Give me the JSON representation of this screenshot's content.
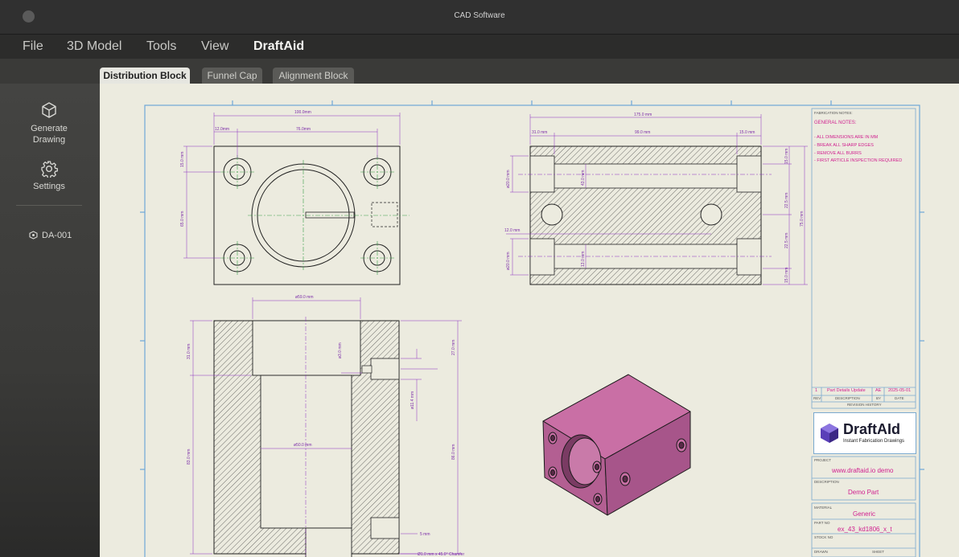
{
  "window": {
    "title": "CAD Software"
  },
  "menu": [
    "File",
    "3D Model",
    "Tools",
    "View",
    "DraftAid"
  ],
  "tabs": [
    "Distribution Block",
    "Funnel Cap",
    "Alignment Block"
  ],
  "sidebar": {
    "generate_label": "Generate Drawing",
    "settings_label": "Settings",
    "document": "DA-001"
  },
  "drawing": {
    "notes_header": "FABRICATION NOTES:",
    "notes_title": "GENERAL NOTES:",
    "notes": [
      "- ALL DIMENSIONS ARE IN MM",
      "- BREAK ALL SHARP EDGES",
      "- REMOVE ALL BURRS",
      "- FIRST ARTICLE INSPECTION REQUIRED"
    ],
    "revision": {
      "rev": "1",
      "description": "Part Details Update",
      "by": "AE",
      "date": "2025-05-01",
      "col_rev": "REV",
      "col_desc": "DESCRIPTION",
      "col_by": "BY",
      "col_date": "DATE",
      "footer": "REVISION HISTORY"
    },
    "logo": {
      "name": "DraftAId",
      "tagline": "Instant Fabrication Drawings"
    },
    "project_label": "PROJECT",
    "project": "www.draftaid.io demo",
    "description_label": "DESCRIPTION",
    "description": "Demo Part",
    "material_label": "MATERIAL",
    "material": "Generic",
    "part_no_label": "PART NO",
    "part_no": "ex_43_kd1806_x_t",
    "stock_no_label": "STOCK NO",
    "drawn_label": "DRAWN",
    "sheet_label": "SHEET",
    "dims": {
      "top_overall": "100.0mm",
      "top_left": "12.0mm",
      "top_mid": "76.0mm",
      "top_left_v1": "15.0 mm",
      "top_left_v2": "65.0 mm",
      "side_overall": "175.0 mm",
      "side_left": "31.0 mm",
      "side_mid": "99.0 mm",
      "side_right": "15.0 mm",
      "side_v_left1": "ø20.0 mm",
      "side_v_left2": "ø20.0 mm",
      "side_v_in1": "43.0 mm",
      "side_v_in2": "13.0 mm",
      "side_h_left": "12.0 mm",
      "side_r1": "15.0 mm",
      "side_r2": "22.5 mm",
      "side_r3": "22.5 mm",
      "side_r4": "15.0 mm",
      "side_r_total": "75.0 mm",
      "sec_top": "ø59.0 mm",
      "sec_bore": "ø50.0 mm",
      "sec_left1": "31.0 mm",
      "sec_left2": "83.0 mm",
      "sec_right1": "27.0 mm",
      "sec_right2": "86.0 mm",
      "sec_small1": "ø3.0 mm",
      "sec_small2": "ø11.4 mm",
      "sec_bottom": "5 mm",
      "chamfer": "Ø1.0 mm x 45.0° Chamfer"
    }
  }
}
